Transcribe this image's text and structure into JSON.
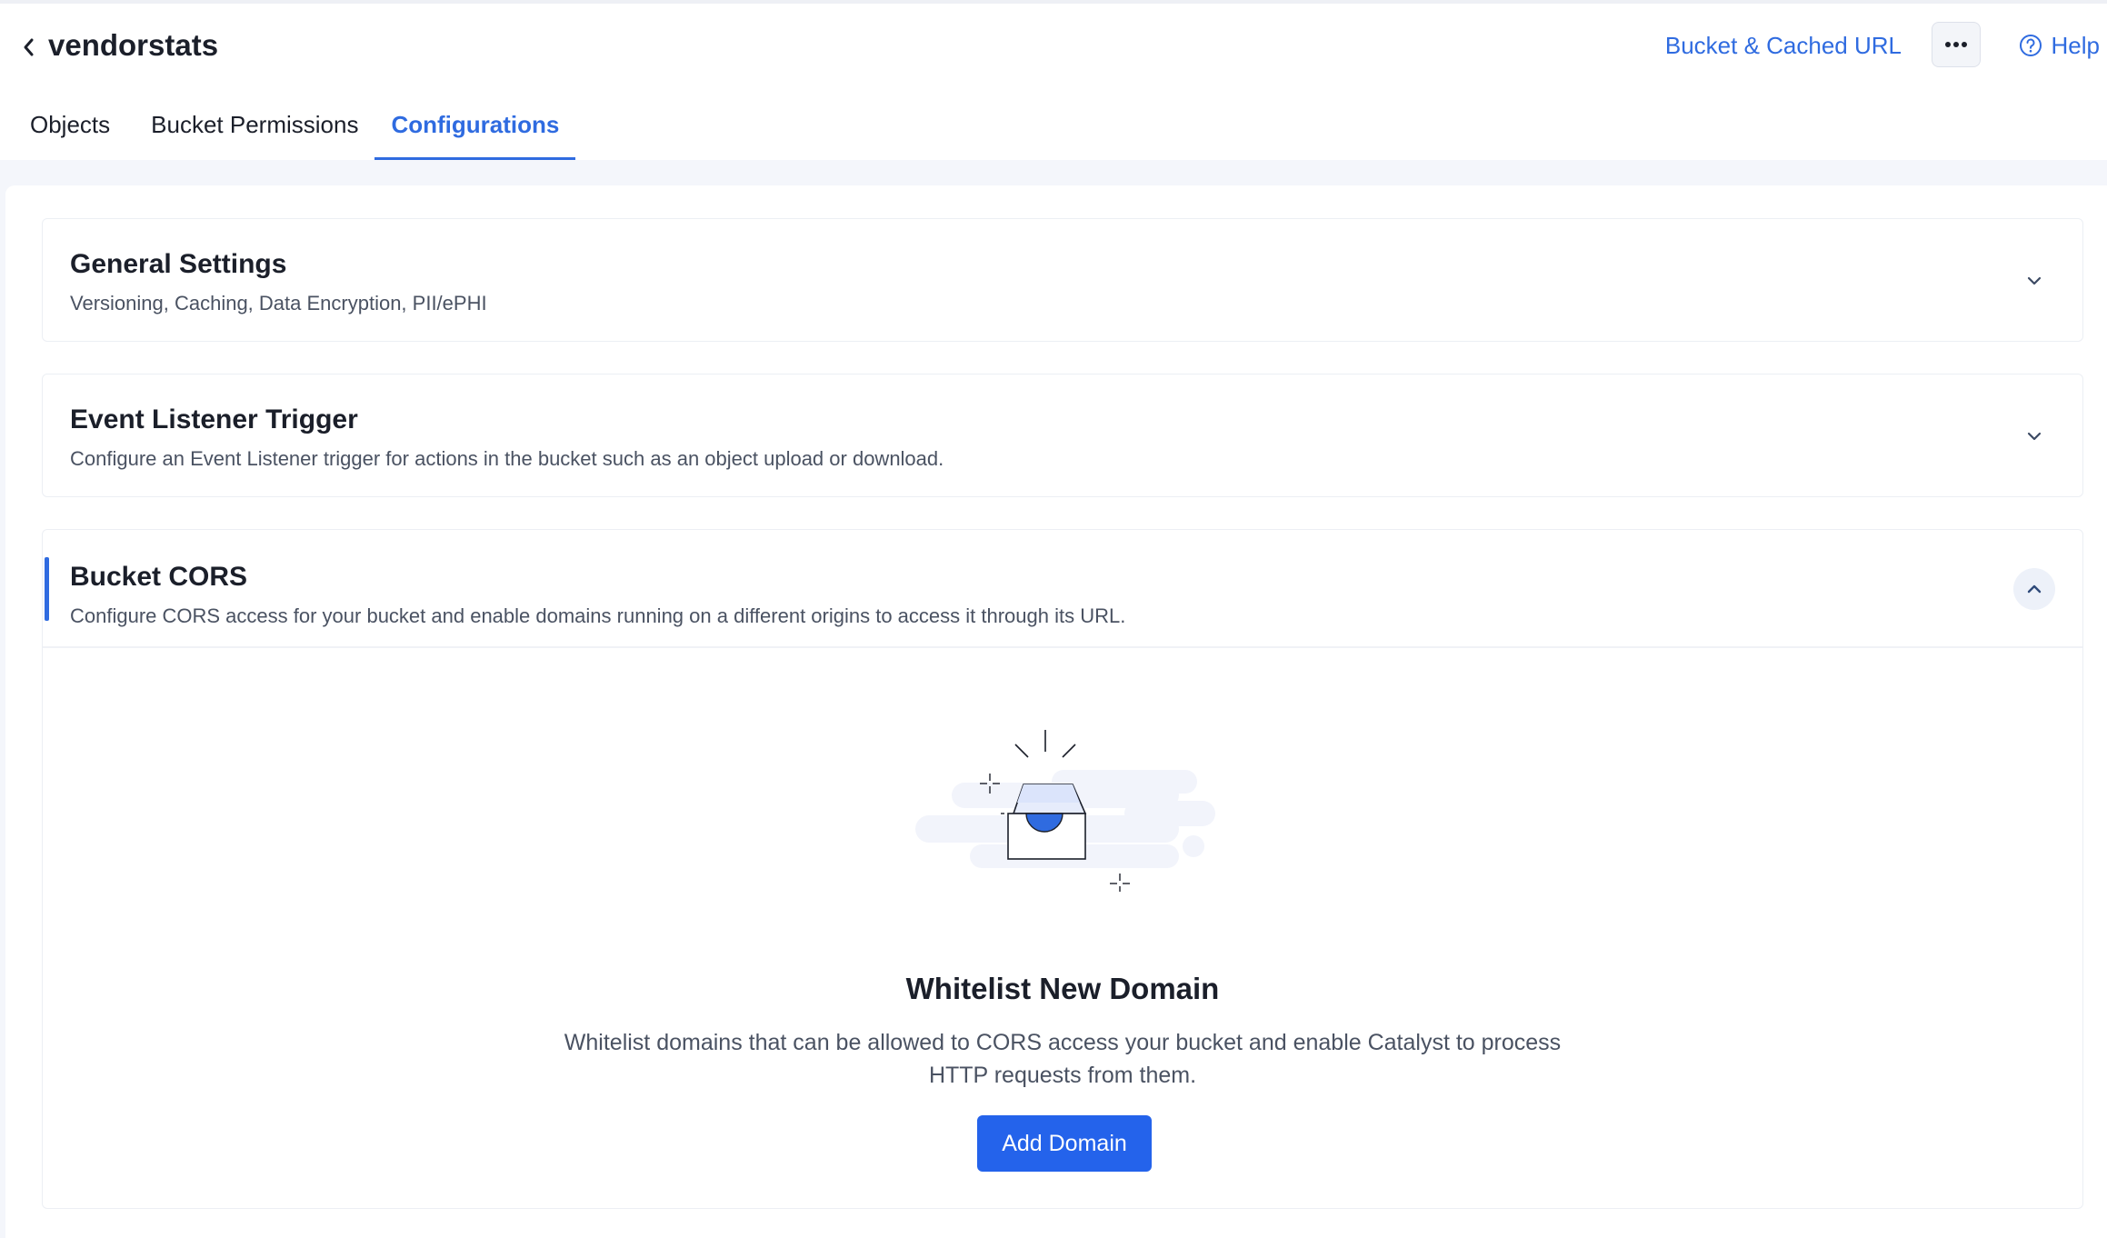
{
  "header": {
    "title": "vendorstats",
    "bucket_link": "Bucket & Cached URL",
    "help_label": "Help"
  },
  "tabs": [
    {
      "label": "Objects",
      "active": false
    },
    {
      "label": "Bucket Permissions",
      "active": false
    },
    {
      "label": "Configurations",
      "active": true
    }
  ],
  "sections": [
    {
      "title": "General Settings",
      "subtitle": "Versioning, Caching, Data Encryption, PII/ePHI",
      "expanded": false
    },
    {
      "title": "Event Listener Trigger",
      "subtitle": "Configure an Event Listener trigger for actions in the bucket such as an object upload or download.",
      "expanded": false
    },
    {
      "title": "Bucket CORS",
      "subtitle": "Configure CORS access for your bucket and enable domains running on a different origins to access it through its URL.",
      "expanded": true
    }
  ],
  "empty_state": {
    "title": "Whitelist New Domain",
    "description": "Whitelist domains that can be allowed to CORS access your bucket and enable Catalyst to process HTTP requests from them.",
    "button_label": "Add Domain"
  },
  "colors": {
    "accent": "#2f6be0",
    "button": "#2463eb"
  },
  "icons": [
    "chevron-left-icon",
    "more-horizontal-icon",
    "help-circle-icon",
    "chevron-down-icon",
    "chevron-up-icon",
    "empty-tray-illustration"
  ]
}
